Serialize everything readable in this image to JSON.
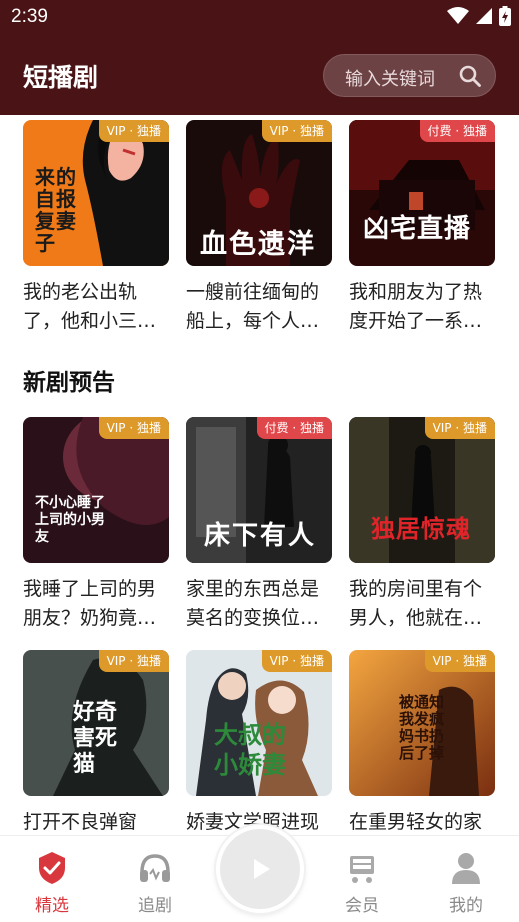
{
  "status_bar": {
    "time": "2:39"
  },
  "header": {
    "title": "短播剧",
    "search_placeholder": "输入关键词"
  },
  "section_top": {
    "cards": [
      {
        "badge": "VIP · 独播",
        "badge_type": "vip",
        "cover_text": "来的自报复妻子",
        "desc": "我的老公出轨了，他和小三在我们的婚房里…"
      },
      {
        "badge": "VIP · 独播",
        "badge_type": "vip",
        "cover_text": "血色遗洋",
        "desc": "一艘前往缅甸的船上，每个人都心怀鬼胎…"
      },
      {
        "badge": "付费 · 独播",
        "badge_type": "paid",
        "cover_text": "凶宅直播",
        "desc": "我和朋友为了热度开始了一系列凶宅直播…"
      }
    ]
  },
  "section_new": {
    "title": "新剧预告",
    "cards": [
      {
        "badge": "VIP · 独播",
        "badge_type": "vip",
        "cover_text": "不小心睡了上司的小男友",
        "desc": "我睡了上司的男朋友？奶狗竟然是…"
      },
      {
        "badge": "付费 · 独播",
        "badge_type": "paid",
        "cover_text": "床下有人",
        "desc": "家里的东西总是莫名的变换位置…"
      },
      {
        "badge": "VIP · 独播",
        "badge_type": "vip",
        "cover_text": "独居惊魂",
        "desc": "我的房间里有个男人，他就在…"
      },
      {
        "badge": "VIP · 独播",
        "badge_type": "vip",
        "cover_text": "好奇害死猫",
        "desc": "打开不良弹窗"
      },
      {
        "badge": "VIP · 独播",
        "badge_type": "vip",
        "cover_text": "大叔的小娇妻",
        "desc": "娇妻文学照进现"
      },
      {
        "badge": "VIP · 独播",
        "badge_type": "vip",
        "cover_text": "被通知我发疯妈书扔后了掉",
        "desc": "在重男轻女的家"
      }
    ]
  },
  "tabbar": {
    "tabs": [
      {
        "label": "精选",
        "icon": "shield-check-icon",
        "active": true
      },
      {
        "label": "追剧",
        "icon": "headphones-icon",
        "active": false
      },
      {
        "label": "会员",
        "icon": "cart-icon",
        "active": false
      },
      {
        "label": "我的",
        "icon": "person-icon",
        "active": false
      }
    ],
    "center_icon": "play-icon"
  },
  "colors": {
    "header_bg": "#4a1416",
    "accent": "#d8383d",
    "vip_badge": "#dd9a2a",
    "paid_badge": "#e0474a"
  }
}
